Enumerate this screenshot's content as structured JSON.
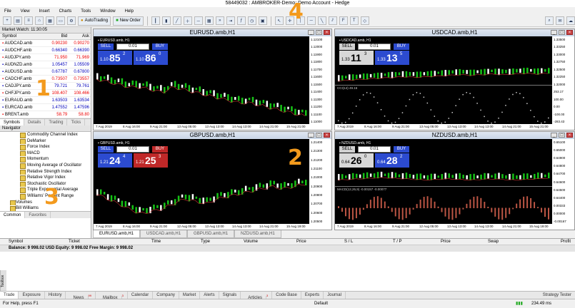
{
  "window": {
    "title": "58449032 : AMBROKER-Demo: Demo Account - Hedge"
  },
  "menu": [
    "File",
    "View",
    "Insert",
    "Charts",
    "Tools",
    "Window",
    "Help"
  ],
  "toolbar": {
    "new_order": "New Order",
    "autotrading": "AutoTrading",
    "period": "H1"
  },
  "market_watch": {
    "header": "Market Watch: 11:30:05",
    "columns": [
      "Symbol",
      "Bid",
      "Ask"
    ],
    "rows": [
      {
        "symbol": "AUDCAD.amb",
        "bid": "0.90230",
        "ask": "0.90270",
        "dir": "dn"
      },
      {
        "symbol": "AUDCHF.amb",
        "bid": "0.66340",
        "ask": "0.66390",
        "dir": "up"
      },
      {
        "symbol": "AUDJPY.amb",
        "bid": "71.950",
        "ask": "71.969",
        "dir": "dn"
      },
      {
        "symbol": "AUDNZD.amb",
        "bid": "1.05457",
        "ask": "1.05509",
        "dir": "up"
      },
      {
        "symbol": "AUDUSD.amb",
        "bid": "0.67787",
        "ask": "0.67800",
        "dir": "up"
      },
      {
        "symbol": "CADCHF.amb",
        "bid": "0.73507",
        "ask": "0.73557",
        "dir": "dn"
      },
      {
        "symbol": "CADJPY.amb",
        "bid": "79.721",
        "ask": "79.761",
        "dir": "up"
      },
      {
        "symbol": "CHFJPY.amb",
        "bid": "108.407",
        "ask": "108.466",
        "dir": "dn"
      },
      {
        "symbol": "EURAUD.amb",
        "bid": "1.63503",
        "ask": "1.63534",
        "dir": "up"
      },
      {
        "symbol": "EURCAD.amb",
        "bid": "1.47552",
        "ask": "1.47596",
        "dir": "up"
      },
      {
        "symbol": "BRENT.amb",
        "bid": "58.79",
        "ask": "58.80",
        "dir": "dn"
      }
    ],
    "tabs": [
      "Symbols",
      "Details",
      "Trading",
      "Ticks"
    ]
  },
  "navigator": {
    "header": "Navigator",
    "items": [
      "Commodity Channel Index",
      "DeMarker",
      "Force Index",
      "MACD",
      "Momentum",
      "Moving Average of Oscillator",
      "Relative Strength Index",
      "Relative Vigor Index",
      "Stochastic Oscillator",
      "Triple Exponential Average",
      "Williams' Percent Range"
    ],
    "groups": [
      "Volumes",
      "Bill Williams"
    ],
    "tabs": [
      "Common",
      "Favorites"
    ]
  },
  "callouts": [
    "1",
    "2",
    "3",
    "4"
  ],
  "charts": [
    {
      "title": "EURUSD.amb,H1",
      "sym": "EURUSD.amb, H1",
      "sell": "SELL",
      "buy": "BUY",
      "lot": "0.01",
      "sell_pfx": "1.10",
      "sell_big": "85",
      "sell_sup": "2",
      "buy_pfx": "1.10",
      "buy_big": "86",
      "buy_sup": "0",
      "y": [
        "1.12100",
        "1.12000",
        "1.11900",
        "1.11800",
        "1.11700",
        "1.11600",
        "1.11500",
        "1.11400",
        "1.11300",
        "1.11200",
        "1.11100",
        "1.11000"
      ],
      "x": [
        "7 Aug 2019",
        "8 Aug 16:00",
        "9 Aug 21:00",
        "13 Aug 05:00",
        "13 Aug 13:00",
        "14 Aug 13:00",
        "14 Aug 21:00",
        "15 Aug 21:00"
      ],
      "sty": "blue"
    },
    {
      "title": "USDCAD.amb,H1",
      "sym": "USDCAD.amb, H1",
      "sell": "SELL",
      "buy": "BUY",
      "lot": "0.01",
      "sell_pfx": "1.33",
      "sell_big": "11",
      "sell_sup": "3",
      "buy_pfx": "1.33",
      "buy_big": "13",
      "buy_sup": "5",
      "sub_label": "CCI(14) 49.16",
      "y": [
        "1.33500",
        "1.33250",
        "1.33000",
        "1.32750",
        "1.32500",
        "1.32250",
        "1.32000",
        "253.17",
        "100.00",
        "0.00",
        "-100.00",
        "-283.43"
      ],
      "x": [
        "7 Aug 2019",
        "8 Aug 16:00",
        "9 Aug 21:00",
        "13 Aug 05:00",
        "13 Aug 13:00",
        "14 Aug 13:00",
        "14 Aug 21:00",
        "15 Aug 21:00"
      ],
      "sty": "white"
    },
    {
      "title": "GBPUSD.amb,H1",
      "sym": "GBPUSD.amb, H1",
      "sell": "SELL",
      "buy": "BUY",
      "lot": "0.01",
      "sell_pfx": "1.21",
      "sell_big": "24",
      "sell_sup": "4",
      "buy_pfx": "1.21",
      "buy_big": "25",
      "buy_sup": "3",
      "y": [
        "1.21400",
        "1.21300",
        "1.21200",
        "1.21100",
        "1.21000",
        "1.20900",
        "1.20800",
        "1.20700",
        "1.20600",
        "1.20500"
      ],
      "x": [
        "7 Aug 2019",
        "8 Aug 16:00",
        "9 Aug 21:00",
        "12 Aug 05:00",
        "13 Aug 13:00",
        "14 Aug 13:00",
        "14 Aug 21:00",
        "15 Aug 19:00"
      ],
      "sty": "red"
    },
    {
      "title": "NZDUSD.amb,H1",
      "sym": "NZDUSD.amb, H1",
      "sell": "SELL",
      "buy": "BUY",
      "lot": "0.01",
      "sell_pfx": "0.64",
      "sell_big": "26",
      "sell_sup": "0",
      "buy_pfx": "0.64",
      "buy_big": "28",
      "buy_sup": "2",
      "sub_label": "MACD(12,26,9) -0.00157 -0.00077",
      "y": [
        "0.65100",
        "0.65000",
        "0.64900",
        "0.64800",
        "0.64700",
        "0.64600",
        "0.64500",
        "0.64400",
        "0.00333",
        "0.00000",
        "-0.00167"
      ],
      "x": [
        "7 Aug 2019",
        "8 Aug 16:00",
        "9 Aug 21:00",
        "12 Aug 05:00",
        "13 Aug 13:00",
        "14 Aug 13:00",
        "14 Aug 21:00",
        "15 Aug 19:00"
      ],
      "sty": "white"
    }
  ],
  "chart_tabs": [
    "EURUSD.amb,H1",
    "USDCAD.amb,H1",
    "GBPUSD.amb,H1",
    "NZDUSD.amb,H1"
  ],
  "terminal": {
    "columns": [
      "Symbol",
      "Ticket",
      "Time",
      "Type",
      "Volume",
      "Price",
      "S / L",
      "T / P",
      "Price",
      "Swap",
      "Profit"
    ],
    "balance": "Balance: 9 998.02 USD  Equity: 9 998.02  Free Margin: 9 998.02",
    "side_label": "Toolbox",
    "tabs": [
      "Trade",
      "Exposure",
      "History",
      "News",
      "Mailbox",
      "Calendar",
      "Company",
      "Market",
      "Alerts",
      "Signals",
      "Articles",
      "Code Base",
      "Experts",
      "Journal"
    ],
    "news_badge": "99",
    "mailbox_badge": "3",
    "articles_badge": "3",
    "strategy_tester": "Strategy Tester"
  },
  "status": {
    "help": "For Help, press F1",
    "profile": "Default",
    "traffic": "234.49 ms"
  }
}
